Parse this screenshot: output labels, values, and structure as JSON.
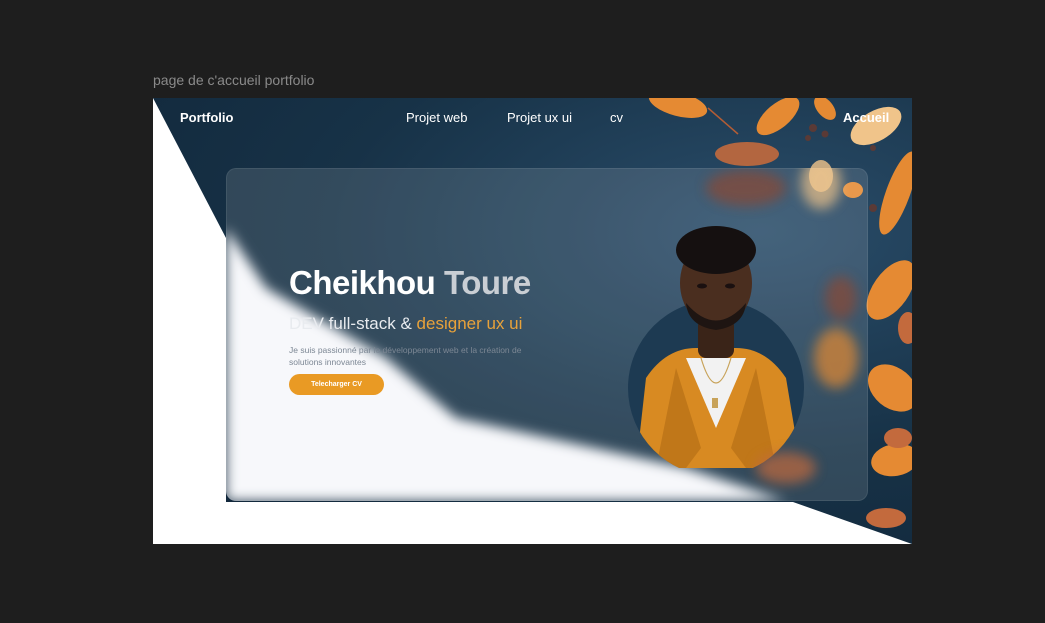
{
  "canvas": {
    "frame_label": "page de c'accueil portfolio"
  },
  "nav": {
    "brand": "Portfolio",
    "links": [
      "Projet web",
      "Projet ux ui",
      "cv"
    ],
    "home": "Accueil"
  },
  "hero": {
    "first_name": "Cheikhou",
    "last_name": "Toure",
    "role_part1": "DEV full-stack & ",
    "role_part2": "designer ux ui",
    "description": "Je suis passionné par le développement web et la création de solutions innovantes",
    "cta_label": "Telecharger CV"
  },
  "colors": {
    "accent": "#e99a24",
    "navy": "#173247",
    "white": "#ffffff"
  }
}
